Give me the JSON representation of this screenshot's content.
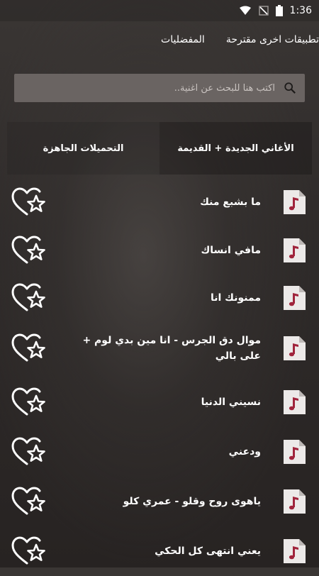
{
  "status_bar": {
    "time": "1:36",
    "icons": [
      "wifi-icon",
      "no-signal-icon",
      "battery-icon"
    ]
  },
  "top_nav": {
    "items": [
      "تطبيقات اخرى مقترحة",
      "المفضليات"
    ]
  },
  "search": {
    "placeholder": "اكتب هنا للبحث عن اغنية.."
  },
  "tabs": {
    "items": [
      "الأغاني الجديدة + القديمة",
      "التحميلات الجاهزة"
    ]
  },
  "songs": [
    {
      "title": "ما بشبع منك"
    },
    {
      "title": "مافي انساك"
    },
    {
      "title": "ممنونك انا"
    },
    {
      "title": "موال دق الجرس - انا مين بدي لوم + على بالي"
    },
    {
      "title": "نسيني الدنيا"
    },
    {
      "title": "ودعني"
    },
    {
      "title": "ياهوى روح وقلو - عمري كلو"
    },
    {
      "title": "يعني انتهى كل الحكي"
    }
  ],
  "colors": {
    "accent": "#a0243c",
    "search_bg": "#6a6462",
    "text": "#ffffff"
  }
}
